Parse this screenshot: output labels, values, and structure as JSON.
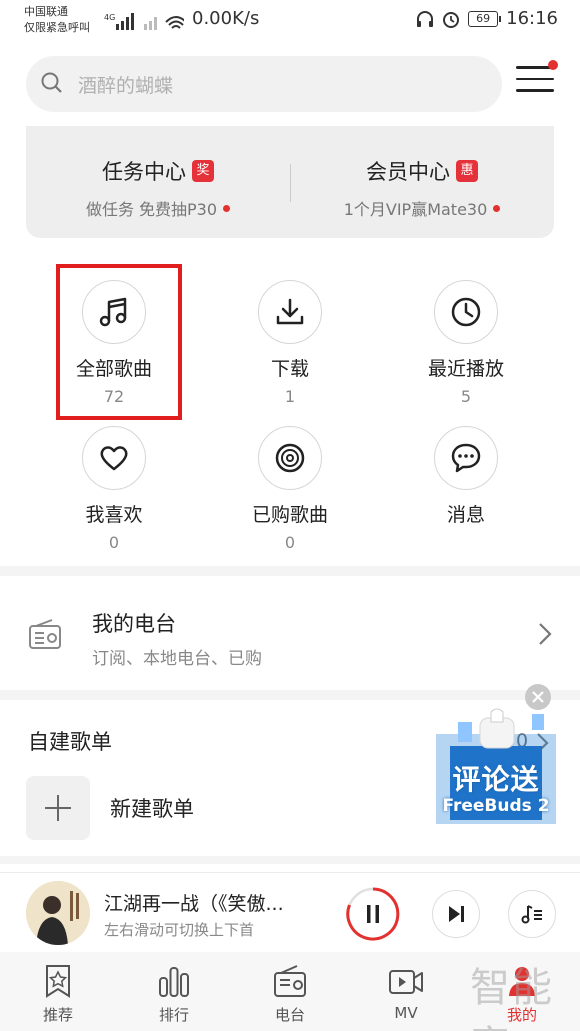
{
  "status_bar": {
    "carrier_line1": "中国联通",
    "carrier_line2": "仅限紧急呼叫",
    "net_speed": "0.00K/s",
    "battery": "69",
    "time": "16:16"
  },
  "search": {
    "placeholder": "酒醉的蝴蝶"
  },
  "task_card": {
    "task_title": "任务中心",
    "task_badge": "奖",
    "task_sub": "做任务 免费抽P30",
    "vip_title": "会员中心",
    "vip_badge": "惠",
    "vip_sub": "1个月VIP赢Mate30"
  },
  "grid": [
    {
      "label": "全部歌曲",
      "count": "72"
    },
    {
      "label": "下载",
      "count": "1"
    },
    {
      "label": "最近播放",
      "count": "5"
    },
    {
      "label": "我喜欢",
      "count": "0"
    },
    {
      "label": "已购歌曲",
      "count": "0"
    },
    {
      "label": "消息",
      "count": ""
    }
  ],
  "radio": {
    "title": "我的电台",
    "subtitle": "订阅、本地电台、已购"
  },
  "playlists": {
    "header": "自建歌单",
    "count": "0",
    "new_label": "新建歌单"
  },
  "ad": {
    "big_text": "评论送",
    "small_text": "FreeBuds 2"
  },
  "player": {
    "title": "江湖再一战（《笑傲...",
    "hint": "左右滑动可切换上下首"
  },
  "nav": [
    "推荐",
    "排行",
    "电台",
    "MV",
    "我的"
  ],
  "watermark": "智能家",
  "colors": {
    "accent": "#e3312f",
    "highlight": "#e01e1e"
  }
}
